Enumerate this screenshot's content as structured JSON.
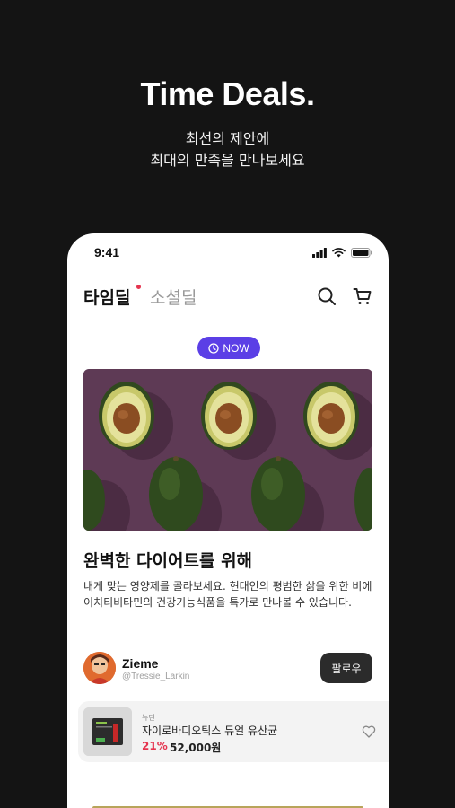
{
  "hero": {
    "title": "Time Deals.",
    "subtitle_line1": "최선의 제안에",
    "subtitle_line2": "최대의 만족을 만나보세요"
  },
  "status_bar": {
    "time": "9:41"
  },
  "header": {
    "tab_active": "타임딜",
    "tab_inactive": "소셜딜",
    "accent": "#e5344f"
  },
  "badge": {
    "label": "NOW",
    "color": "#5b3fe6"
  },
  "deal": {
    "image": "avocado-halves-on-purple",
    "title": "완벽한 다이어트를 위해",
    "description": "내게 맞는 영양제를 골라보세요. 현대인의 평범한 삶을 위한 비에이치티비타민의 건강기능식품을 특가로 만나볼 수 있습니다."
  },
  "seller": {
    "name": "Zieme",
    "handle": "@Tressie_Larkin",
    "follow_label": "팔로우"
  },
  "product": {
    "brand": "뉴틴",
    "name": "자이로바디오틱스 듀얼 유산균",
    "discount": "21%",
    "price": "52,000원"
  }
}
